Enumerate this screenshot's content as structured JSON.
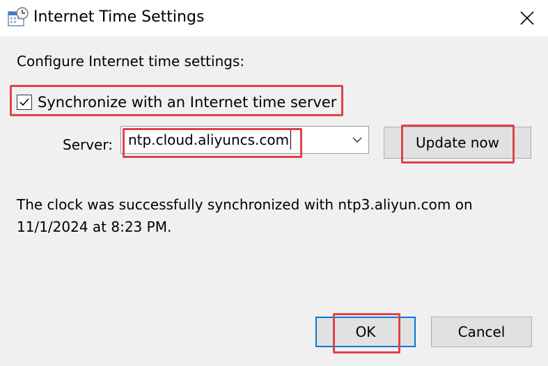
{
  "window": {
    "title": "Internet Time Settings"
  },
  "icons": {
    "app": "clock-calendar-icon",
    "close": "close-icon",
    "checkbox": "checkmark-icon",
    "dropdown": "chevron-down-icon"
  },
  "main": {
    "configure_label": "Configure Internet time settings:",
    "sync_checkbox": {
      "label": "Synchronize with an Internet time server",
      "checked": true
    },
    "server_label": "Server:",
    "server_value": "ntp.cloud.aliyuncs.com",
    "update_button": "Update now",
    "status_text": "The clock was successfully synchronized with ntp3.aliyun.com on 11/1/2024 at 8:23 PM."
  },
  "footer": {
    "ok_button": "OK",
    "cancel_button": "Cancel"
  },
  "colors": {
    "highlight": "#e0424a",
    "focus_border": "#0078d7",
    "button_face": "#e1e1e1",
    "dialog_background": "#f0f0f0"
  }
}
